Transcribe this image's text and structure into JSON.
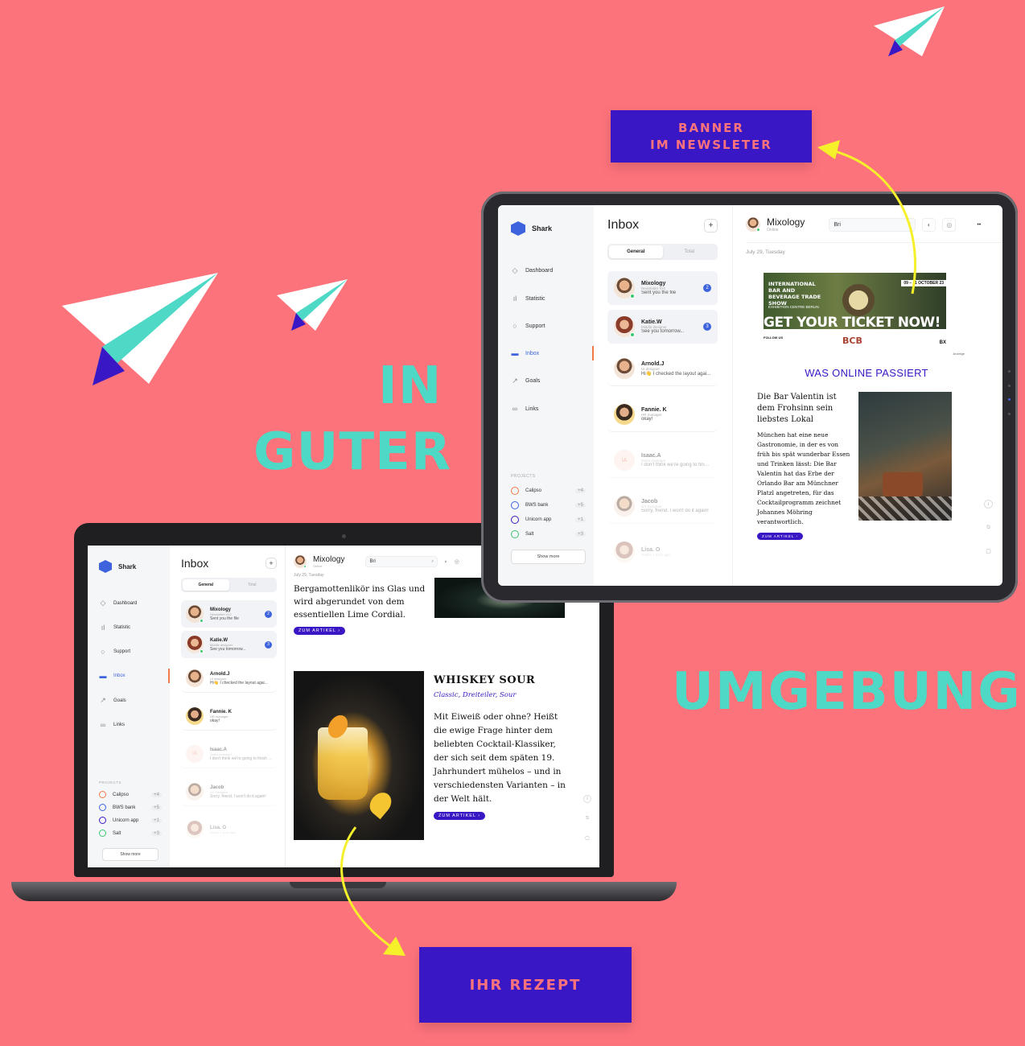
{
  "headlines": {
    "in": "IN",
    "guter": "GUTER",
    "umgebung": "UMGEBUNG"
  },
  "callouts": {
    "banner_line1": "BANNER",
    "banner_line2": "IM NEWSLETER",
    "recipe": "IHR REZEPT"
  },
  "colors": {
    "background": "#fd737c",
    "accent_teal": "#4ed8c6",
    "callout_bg": "#3a17c4",
    "arrow": "#f5f02a"
  },
  "app": {
    "brand": "Shark",
    "nav": [
      {
        "label": "Dashboard",
        "icon": "layers-icon"
      },
      {
        "label": "Statistic",
        "icon": "bar-chart-icon"
      },
      {
        "label": "Support",
        "icon": "chat-bubble-icon"
      },
      {
        "label": "Inbox",
        "icon": "inbox-icon"
      },
      {
        "label": "Goals",
        "icon": "rocket-icon"
      },
      {
        "label": "Links",
        "icon": "link-icon"
      }
    ],
    "projects_title": "PROJECTS",
    "projects": [
      {
        "name": "Calipso",
        "count": "+4",
        "color": "#f07a4a"
      },
      {
        "name": "BWS bank",
        "count": "+5",
        "color": "#3d63dd"
      },
      {
        "name": "Unicorn app",
        "count": "+1",
        "color": "#3a17c4"
      },
      {
        "name": "Salt",
        "count": "+3",
        "color": "#3bc872"
      }
    ],
    "show_more": "Show more",
    "inbox_title": "Inbox",
    "plus": "+",
    "tab_general": "General",
    "tab_total": "Total",
    "messages": [
      {
        "name": "Mixology",
        "role": "Newsletter #12",
        "text": "Sent you the file",
        "badge": "2"
      },
      {
        "name": "Katie.W",
        "role": "Middle designer",
        "text": "See you tomorrow...",
        "badge": "3"
      },
      {
        "name": "Arnold.J",
        "role": "UI designer",
        "text": "Hi👋 I checked the layout agai..."
      },
      {
        "name": "Fannie. K",
        "role": "HR manager",
        "text": "okay!"
      },
      {
        "name": "Isaac.A",
        "role": "Sales manager",
        "text": "I don't think we're going to finish ...",
        "initials": "IA"
      },
      {
        "name": "Jacob",
        "role": "UX Designer",
        "text": "Sorry, friend. I won't do it again!"
      },
      {
        "name": "Lisa. O",
        "role": "Online 1 hour ago",
        "text": ""
      }
    ],
    "chat_name": "Mixology",
    "chat_status": "Online",
    "search_value": "Bri",
    "date": "July 29, Tuesday",
    "more_icon": "••"
  },
  "tablet_newsletter": {
    "banner_left": "INTERNATIONAL BAR AND BEVERAGE TRADE SHOW",
    "banner_date": "09 – 11 OCTOBER 23",
    "banner_venue": "EXHIBITION CENTRE BERLIN",
    "banner_cta": "GET YOUR TICKET NOW!",
    "banner_follow": "FOLLOW US",
    "banner_logo": "BCB",
    "banner_ad": "Anzeige",
    "section_title": "WAS ONLINE PASSIERT",
    "article_title": "Die Bar Valentin ist dem Frohsinn sein liebstes Lokal",
    "article_body": "München hat eine neue Gastronomie, in der es von früh bis spät wunderbar Essen und Trinken lässt: Die Bar Valentin hat das Erbe der Orlando Bar am Münchner Platzl angetreten, für das Cocktailprogramm zeichnet Johannes Möhring verantwortlich.",
    "button": "ZUM ARTIKEL ›"
  },
  "laptop_newsletter": {
    "prev_text": "Bergamottenlikör ins Glas und wird abgerundet von dem essentiellen Lime Cordial.",
    "button": "ZUM ARTIKEL ›",
    "recipe_title": "WHISKEY SOUR",
    "recipe_subtitle": "Classic, Dreiteiler, Sour",
    "recipe_body": "Mit Eiweiß oder ohne? Heißt die ewige Frage hinter dem beliebten Cocktail-Klassiker, der sich seit dem späten 19. Jahrhundert mühelos – und in verschiedensten Varianten – in der Welt hält.",
    "recipe_button": "ZUM ARTIKEL ›"
  }
}
